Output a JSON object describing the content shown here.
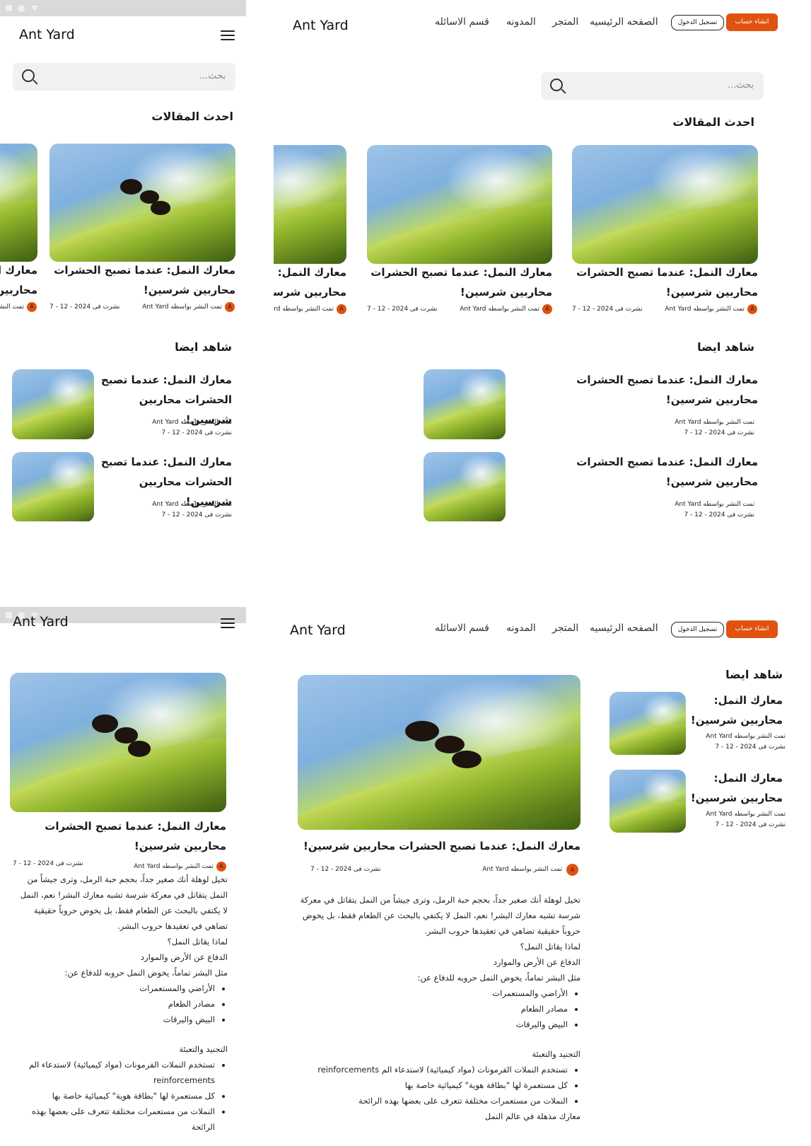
{
  "brand": {
    "name": "Ant Yard",
    "accent": "#e0530f"
  },
  "nav": {
    "home": "الصفحه الرئيسيه",
    "store": "المتجر",
    "blog": "المدونه",
    "faq": "قسم الاسائله",
    "login": "تسجيل الدخول",
    "signup": "انشاء حساب"
  },
  "search": {
    "placeholder": "بحث..."
  },
  "sections": {
    "latest": "احدث المقالات",
    "see_also": "شاهد ايضا"
  },
  "card": {
    "title": "معارك النمل: عندما تصبح الحشرات محاربين شرسين!",
    "title_short": "معارك النمل: محاربين شرسين!",
    "author": "تمت النشر بواسطه Ant Yard",
    "date": "نشرت فى 2024 - 12 - 7",
    "avatar_letter": "A"
  },
  "article": {
    "intro": "تخيل لوهلة أنك صغير جداً، بحجم حبة الرمل، وترى جيشاً من النمل يتقاتل في معركة شرسة تشبه معارك البشر! نعم، النمل لا يكتفي بالبحث عن الطعام فقط، بل يخوض حروباً حقيقية تضاهي في تعقيدها حروب البشر.",
    "why": "لماذا يقاتل النمل؟",
    "defense": "الدفاع عن الأرض والموارد",
    "like_humans": "مثل البشر تماماً، يخوض النمل حروبه للدفاع عن:",
    "defense_list": [
      "الأراضي والمستعمرات",
      "مصادر الطعام",
      "البيض واليرقات"
    ],
    "recruit": "التجنيد والتعبئة",
    "recruit_list": [
      "تستخدم النملات الفرمونات (مواد كيميائية) لاستدعاء الم reinforcements",
      "كل مستعمرة لها \"بطاقة هوية\" كيميائية خاصة بها",
      "النملات من مستعمرات مختلفة تتعرف على بعضها بهذه الرائحة"
    ],
    "exciting": "معارك مذهلة في عالم النمل"
  }
}
